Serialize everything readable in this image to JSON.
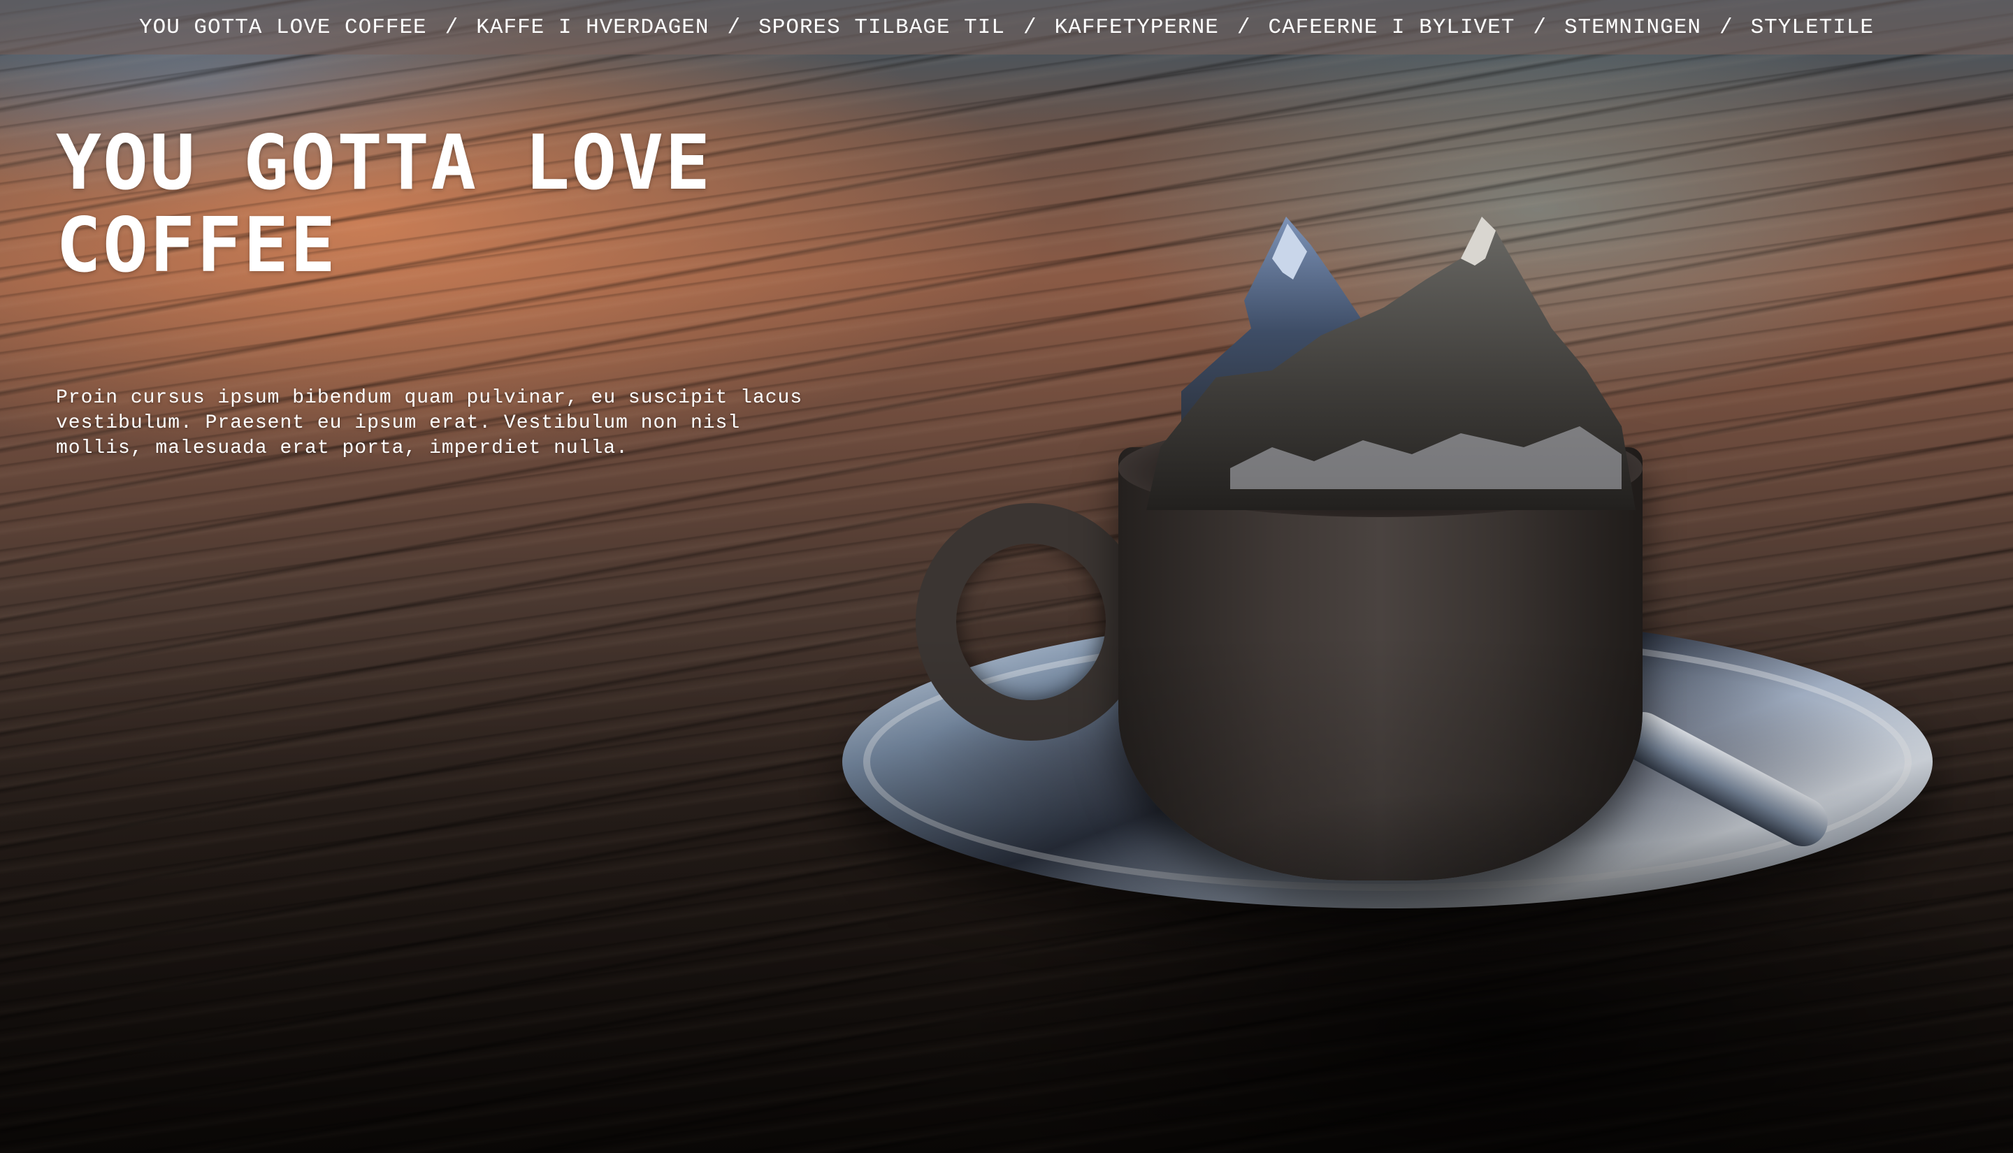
{
  "nav": {
    "items": [
      {
        "label": "YOU GOTTA LOVE COFFEE"
      },
      {
        "label": "KAFFE I HVERDAGEN"
      },
      {
        "label": "SPORES TILBAGE TIL"
      },
      {
        "label": "KAFFETYPERNE"
      },
      {
        "label": "CAFEERNE I BYLIVET"
      },
      {
        "label": "STEMNINGEN"
      },
      {
        "label": "STYLETILE"
      }
    ],
    "separator": "/"
  },
  "hero": {
    "title_line1": "YOU GOTTA LOVE",
    "title_line2": "COFFEE",
    "body_line1": "Proin cursus ipsum bibendum quam pulvinar, eu suscipit lacus",
    "body_line2": "vestibulum. Praesent eu ipsum erat. Vestibulum non nisl",
    "body_line3": "mollis, malesuada erat porta, imperdiet nulla."
  },
  "colors": {
    "text": "#ffffff",
    "nav_background": "#78605a"
  },
  "icons": {
    "background": "coffee-cup-with-mountains-image"
  }
}
